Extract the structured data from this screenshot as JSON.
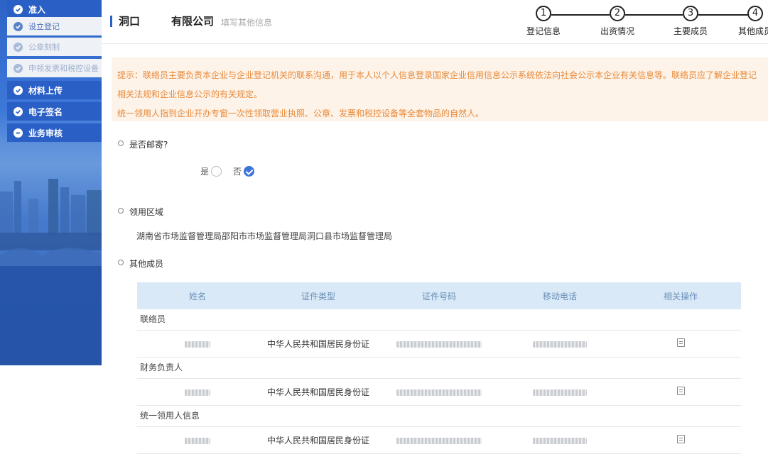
{
  "sidebar": {
    "items": [
      {
        "label": "准入",
        "kind": "top"
      },
      {
        "label": "设立登记",
        "kind": "sub"
      },
      {
        "label": "公章刻制",
        "kind": "sub-faded"
      },
      {
        "label": "申领发票和税控设备",
        "kind": "sub-faded"
      },
      {
        "label": "材料上传",
        "kind": "top"
      },
      {
        "label": "电子签名",
        "kind": "top"
      },
      {
        "label": "业务审核",
        "kind": "top"
      }
    ]
  },
  "header": {
    "company_prefix": "洞口",
    "company_suffix": "有限公司",
    "subtitle": "填写其他信息",
    "steps": [
      {
        "num": "1",
        "label": "登记信息"
      },
      {
        "num": "2",
        "label": "出资情况"
      },
      {
        "num": "3",
        "label": "主要成员"
      },
      {
        "num": "4",
        "label": "其他成员"
      }
    ]
  },
  "notice": {
    "line1": "提示：联络员主要负责本企业与企业登记机关的联系沟通，用于本人以个人信息登录国家企业信用信息公示系统依法向社会公示本企业有关信息等。联络员应了解企业登记相关法规和企业信息公示的有关规定。",
    "line2": "统一领用人指到企业开办专窗一次性领取营业执照、公章、发票和税控设备等全套物品的自然人。"
  },
  "mail": {
    "title": "是否邮寄?",
    "yes_label": "是",
    "no_label": "否",
    "selected": "否"
  },
  "area": {
    "title": "领用区域",
    "value": "湖南省市场监督管理局邵阳市市场监督管理局洞口县市场监督管理局"
  },
  "members": {
    "title": "其他成员",
    "columns": [
      "姓名",
      "证件类型",
      "证件号码",
      "移动电话",
      "相关操作"
    ],
    "groups": [
      {
        "label": "联络员",
        "id_type": "中华人民共和国居民身份证"
      },
      {
        "label": "财务负责人",
        "id_type": "中华人民共和国居民身份证"
      },
      {
        "label": "统一领用人信息",
        "id_type": "中华人民共和国居民身份证"
      }
    ]
  },
  "colors": {
    "primary": "#2a5fc6",
    "notice_text": "#e8893a",
    "notice_bg": "#fdf3e8",
    "table_head": "#d9e9f7"
  }
}
